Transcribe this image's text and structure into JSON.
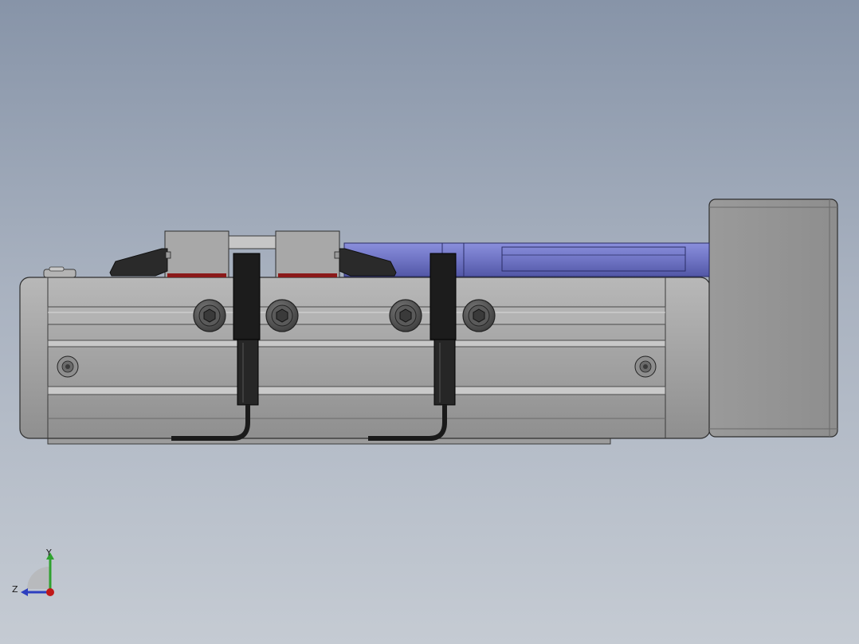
{
  "viewport": {
    "background_top": "#8794a8",
    "background_bottom": "#c5cbd3"
  },
  "model": {
    "body_color": "#a4a4a4",
    "cylinder_color": "#6f74c4",
    "gripper_color": "#2a2a2a",
    "sensor_color": "#1c1c1c",
    "accent_red": "#8b1a1a"
  },
  "triad": {
    "y_label": "Y",
    "z_label": "Z",
    "y_color": "#2fa12f",
    "z_color": "#2d3fbf",
    "x_color": "#c01818"
  }
}
